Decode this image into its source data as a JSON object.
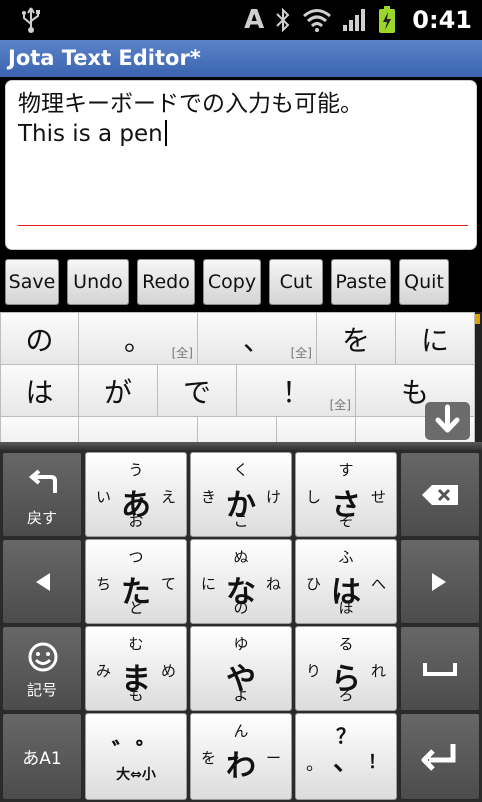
{
  "status_bar": {
    "ime_indicator": "A",
    "time": "0:41",
    "icons": [
      "usb-icon",
      "bluetooth-icon",
      "wifi-icon",
      "signal-icon",
      "battery-icon"
    ]
  },
  "app": {
    "title": "Jota Text Editor*"
  },
  "editor": {
    "line1": "物理キーボードでの入力も可能。",
    "line2": "This is a pen"
  },
  "toolbar": {
    "save": "Save",
    "undo": "Undo",
    "redo": "Redo",
    "copy": "Copy",
    "cut": "Cut",
    "paste": "Paste",
    "quit": "Quit"
  },
  "candidates": {
    "row1": [
      {
        "text": "の",
        "sub": ""
      },
      {
        "text": "。",
        "sub": "[全]"
      },
      {
        "text": "、",
        "sub": "[全]"
      },
      {
        "text": "を",
        "sub": ""
      },
      {
        "text": "に",
        "sub": ""
      }
    ],
    "row2": [
      {
        "text": "は",
        "sub": ""
      },
      {
        "text": "が",
        "sub": ""
      },
      {
        "text": "で",
        "sub": ""
      },
      {
        "text": "！",
        "sub": "[全]"
      },
      {
        "text": "も",
        "sub": ""
      }
    ]
  },
  "keyboard": {
    "back_label": "戻す",
    "symbol_label": "記号",
    "mode_label": "あA1",
    "dakuten_top": "゛゜",
    "dakuten_bottom": "大⇔小",
    "kana": {
      "a": {
        "c": "あ",
        "u": "う",
        "d": "お",
        "l": "い",
        "r": "え"
      },
      "ka": {
        "c": "か",
        "u": "く",
        "d": "こ",
        "l": "き",
        "r": "け"
      },
      "sa": {
        "c": "さ",
        "u": "す",
        "d": "そ",
        "l": "し",
        "r": "せ"
      },
      "ta": {
        "c": "た",
        "u": "つ",
        "d": "と",
        "l": "ち",
        "r": "て"
      },
      "na": {
        "c": "な",
        "u": "ぬ",
        "d": "の",
        "l": "に",
        "r": "ね"
      },
      "ha": {
        "c": "は",
        "u": "ふ",
        "d": "ほ",
        "l": "ひ",
        "r": "へ"
      },
      "ma": {
        "c": "ま",
        "u": "む",
        "d": "も",
        "l": "み",
        "r": "め"
      },
      "ya": {
        "c": "や",
        "u": "ゆ",
        "d": "よ",
        "l": "",
        "r": ""
      },
      "ra": {
        "c": "ら",
        "u": "る",
        "d": "ろ",
        "l": "り",
        "r": "れ"
      },
      "wa": {
        "c": "わ",
        "u": "ん",
        "d": "",
        "l": "を",
        "r": "ー"
      },
      "punct": {
        "c": "、",
        "u": "？",
        "d": "",
        "l": "。",
        "r": "！"
      }
    }
  }
}
